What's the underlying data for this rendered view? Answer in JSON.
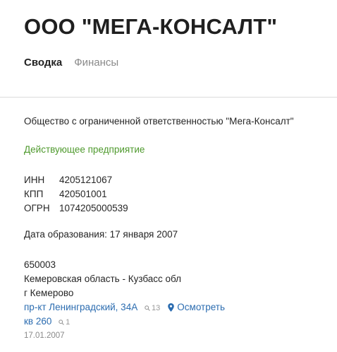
{
  "title": "ООО \"МЕГА-КОНСАЛТ\"",
  "tabs": [
    {
      "label": "Сводка"
    },
    {
      "label": "Финансы"
    }
  ],
  "full_name": "Общество с ограниченной ответственностью \"Мега-Консалт\"",
  "status": "Действующее предприятие",
  "status_color": "#4f9a2e",
  "codes": [
    {
      "label": "ИНН",
      "value": "4205121067"
    },
    {
      "label": "КПП",
      "value": "420501001"
    },
    {
      "label": "ОГРН",
      "value": "1074205000539"
    }
  ],
  "registration": "Дата образования: 17 января 2007",
  "address": {
    "postal_code": "650003",
    "region": "Кемеровская область - Кузбасс обл",
    "city": "г Кемерово",
    "street": "пр-кт Ленинградский, 34А",
    "street_count": "13",
    "view_link": "Осмотреть",
    "apartment": "кв 260",
    "apartment_count": "1",
    "date": "17.01.2007"
  },
  "link_color": "#2b6cb0",
  "icons": [
    "search-icon",
    "map-pin-icon"
  ]
}
